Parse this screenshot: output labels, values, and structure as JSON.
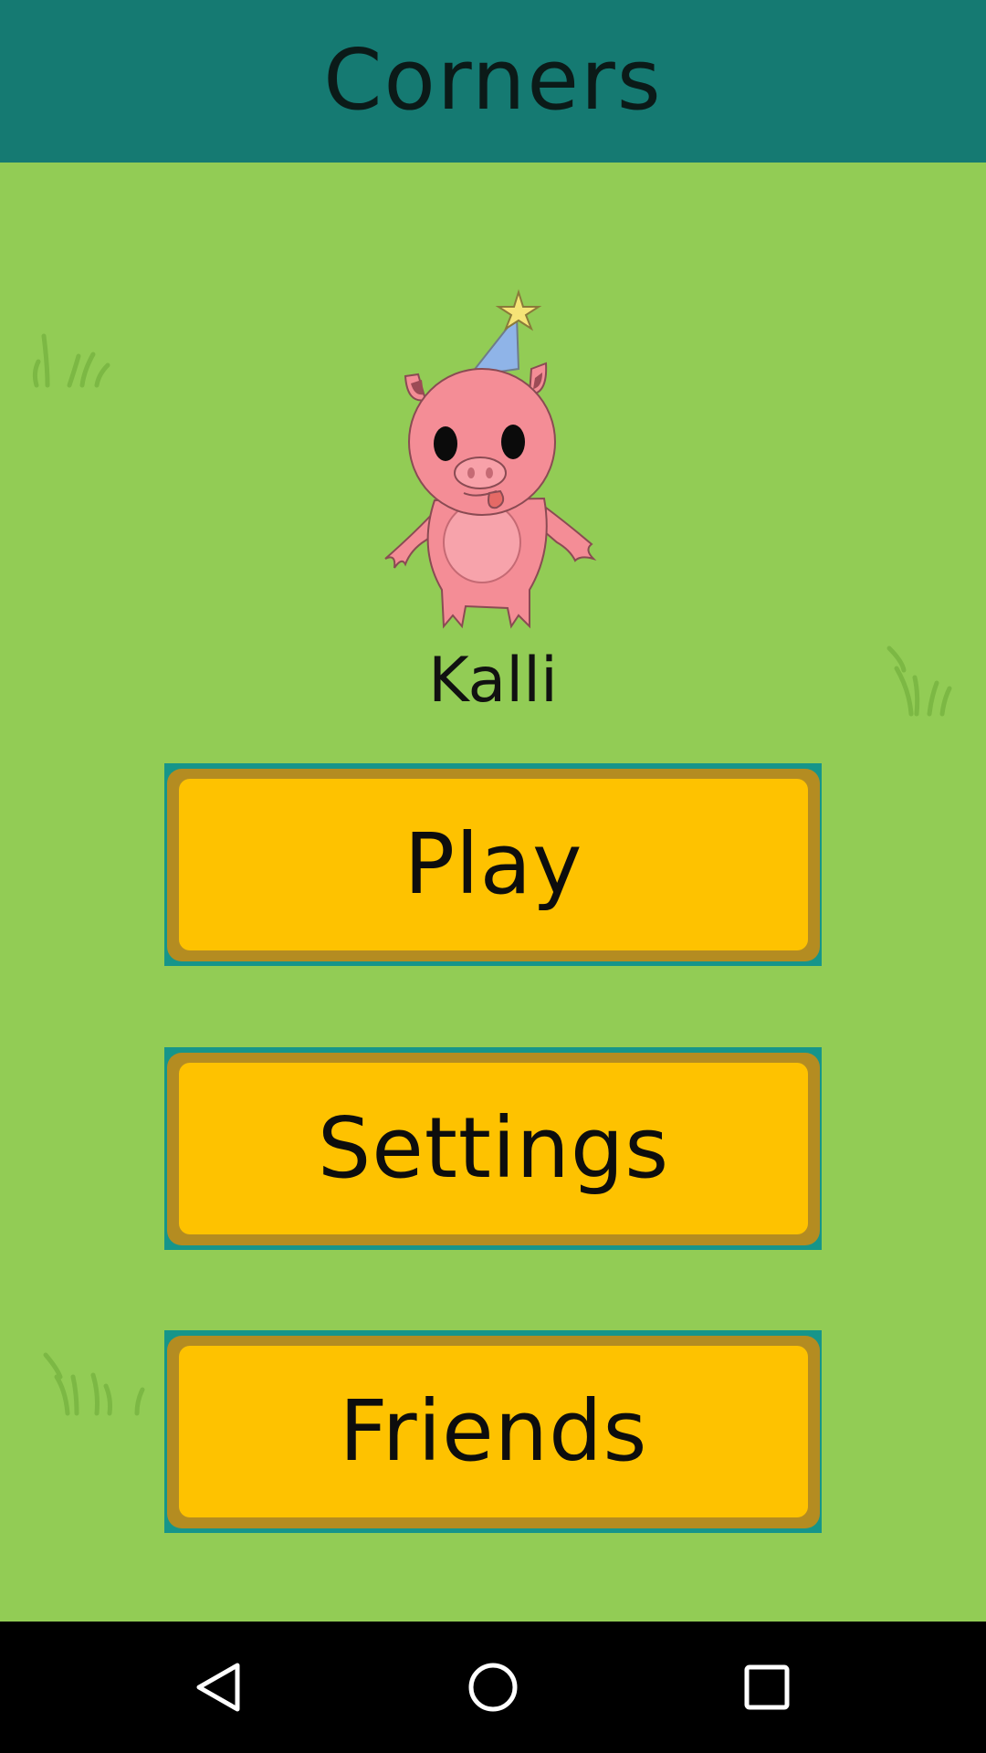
{
  "app": {
    "title": "Corners"
  },
  "player": {
    "name": "Kalli",
    "avatar_icon": "pig-party-hat-icon"
  },
  "menu": {
    "play_label": "Play",
    "settings_label": "Settings",
    "friends_label": "Friends"
  },
  "navigation": {
    "back_icon": "back-triangle-icon",
    "home_icon": "home-circle-icon",
    "recents_icon": "recents-square-icon"
  },
  "colors": {
    "title_bar": "#157a72",
    "background": "#92cc55",
    "button_face": "#fec200",
    "button_frame": "#b48c21",
    "button_outline": "#16958a",
    "nav_bar": "#000000"
  }
}
